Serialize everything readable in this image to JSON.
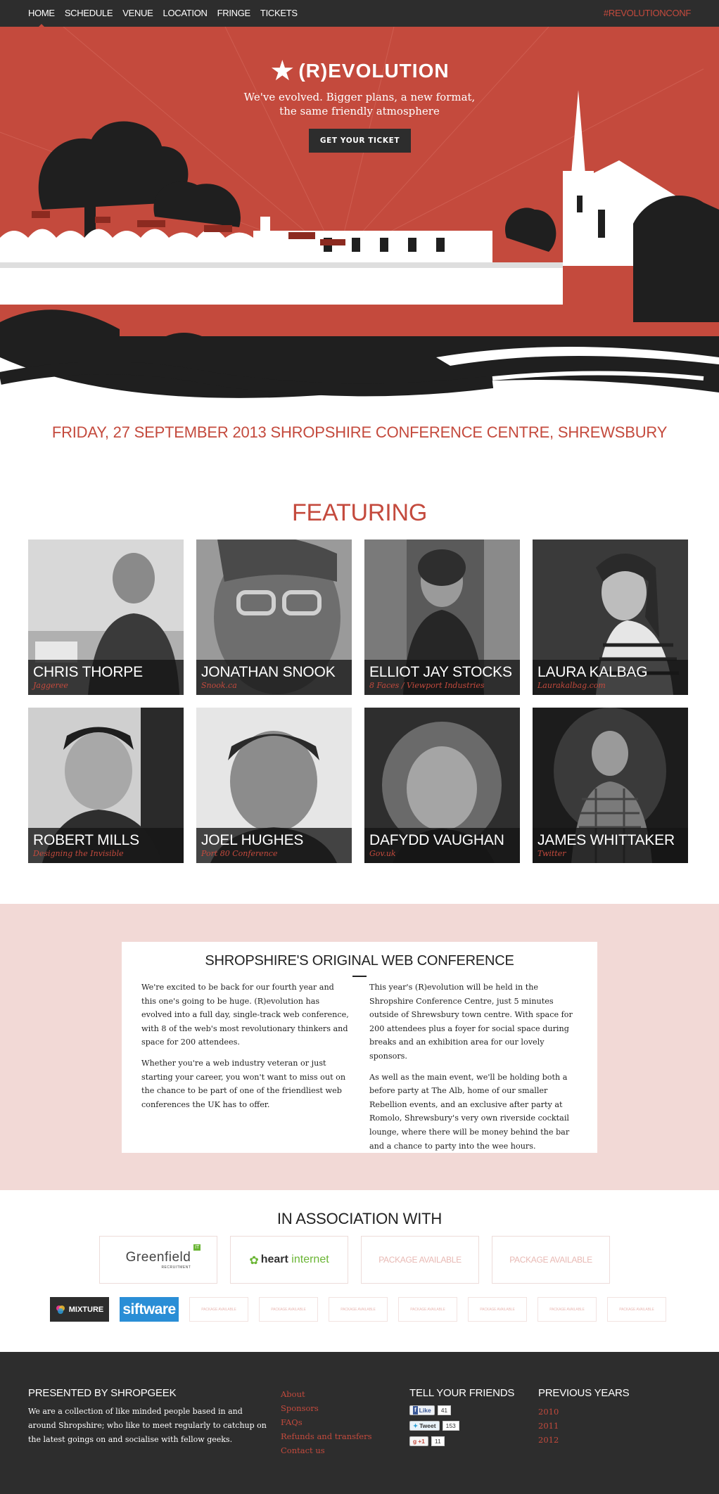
{
  "nav": {
    "items": [
      {
        "label": "HOME",
        "active": true
      },
      {
        "label": "SCHEDULE"
      },
      {
        "label": "VENUE"
      },
      {
        "label": "LOCATION"
      },
      {
        "label": "FRINGE"
      },
      {
        "label": "TICKETS"
      }
    ],
    "hashtag": "#REVOLUTIONCONF"
  },
  "hero": {
    "logo_star": "★",
    "logo_text": "(R)EVOLUTION",
    "tagline_line1": "We've evolved. Bigger plans, a new format,",
    "tagline_line2": "the same friendly atmosphere",
    "cta_label": "GET YOUR TICKET"
  },
  "date_line": "FRIDAY, 27 SEPTEMBER 2013 SHROPSHIRE CONFERENCE CENTRE, SHREWSBURY",
  "featuring": {
    "title": "FEATURING",
    "speakers": [
      {
        "name": "CHRIS THORPE",
        "org": "Jaggeree"
      },
      {
        "name": "JONATHAN SNOOK",
        "org": "Snook.ca"
      },
      {
        "name": "ELLIOT JAY STOCKS",
        "org": "8 Faces / Viewport Industries"
      },
      {
        "name": "LAURA KALBAG",
        "org": "Laurakalbag.com"
      },
      {
        "name": "ROBERT MILLS",
        "org": "Designing the Invisible"
      },
      {
        "name": "JOEL HUGHES",
        "org": "Port 80 Conference"
      },
      {
        "name": "DAFYDD VAUGHAN",
        "org": "Gov.uk"
      },
      {
        "name": "JAMES WHITTAKER",
        "org": "Twitter"
      }
    ]
  },
  "about": {
    "title": "SHROPSHIRE'S ORIGINAL WEB CONFERENCE",
    "col1": [
      "We're excited to be back for our fourth year and this one's going to be huge. (R)evolution has evolved into a full day, single-track web conference, with 8 of the web's most revolutionary thinkers and space for 200 attendees.",
      "Whether you're a web industry veteran or just starting your career, you won't want to miss out on the chance to be part of one of the friendliest web conferences the UK has to offer."
    ],
    "col2": [
      "This year's (R)evolution will be held in the Shropshire Conference Centre, just 5 minutes outside of Shrewsbury town centre. With space for 200 attendees plus a foyer for social space during breaks and an exhibition area for our lovely sponsors.",
      "As well as the main event, we'll be holding both a before party at The Alb, home of our smaller Rebellion events, and an exclusive after party at Romolo, Shrewsbury's very own riverside cocktail lounge, where there will be money behind the bar and a chance to party into the wee hours."
    ]
  },
  "sponsors": {
    "title": "IN ASSOCIATION WITH",
    "greenfield": {
      "name": "Greenfield",
      "badge": "IT",
      "sub": "RECRUITMENT"
    },
    "heart": {
      "name_a": "heart",
      "name_b": " internet"
    },
    "package_label": "PACKAGE AVAILABLE",
    "mixture": "MIXTURE",
    "siftware": "siftware",
    "small_package_label": "PACKAGE AVAILABLE"
  },
  "footer": {
    "presented_title": "PRESENTED BY SHROPGEEK",
    "presented_text": "We are a collection of like minded people based in and around Shropshire; who like to meet regularly to catchup on the latest goings on and socialise with fellow geeks.",
    "links": [
      "About",
      "Sponsors",
      "FAQs",
      "Refunds and transfers",
      "Contact us"
    ],
    "tell_title": "TELL YOUR FRIENDS",
    "share": [
      {
        "label": "Like",
        "count": "41"
      },
      {
        "label": "Tweet",
        "count": "153"
      },
      {
        "label": "+1",
        "count": "11"
      }
    ],
    "years_title": "PREVIOUS YEARS",
    "years": [
      "2010",
      "2011",
      "2012"
    ]
  },
  "colors": {
    "accent": "#c44a3d",
    "dark": "#2d2d2d",
    "pink_band": "#f2d9d6"
  }
}
